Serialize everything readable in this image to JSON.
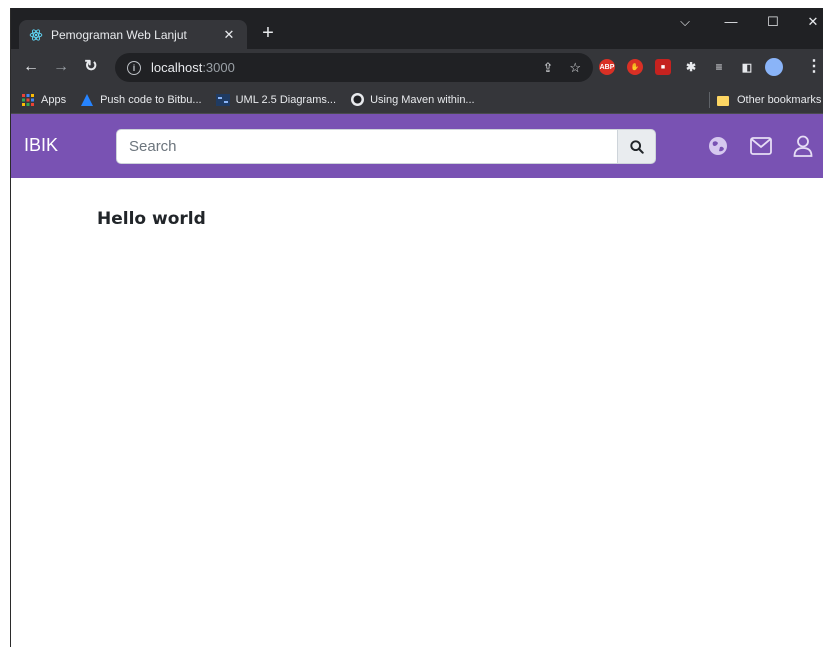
{
  "browser": {
    "tab": {
      "title": "Pemograman Web Lanjut",
      "close": "✕"
    },
    "new_tab": "+",
    "window_controls": {
      "dropdown": "⌵",
      "minimize": "—",
      "maximize": "☐",
      "close": "✕"
    },
    "address": {
      "host": "localhost",
      "port": ":3000"
    },
    "bookmarks": [
      {
        "label": "Apps",
        "icon": "apps-grid-icon"
      },
      {
        "label": "Push code to Bitbu...",
        "icon": "bitbucket-icon"
      },
      {
        "label": "UML 2.5 Diagrams...",
        "icon": "uml-icon"
      },
      {
        "label": "Using Maven within...",
        "icon": "maven-icon"
      }
    ],
    "other_bookmarks": "Other bookmarks",
    "extensions": [
      "ABP"
    ]
  },
  "app": {
    "brand": "IBIK",
    "search": {
      "placeholder": "Search"
    },
    "accent_color": "#7952b3"
  },
  "main": {
    "greeting": "Hello world"
  }
}
